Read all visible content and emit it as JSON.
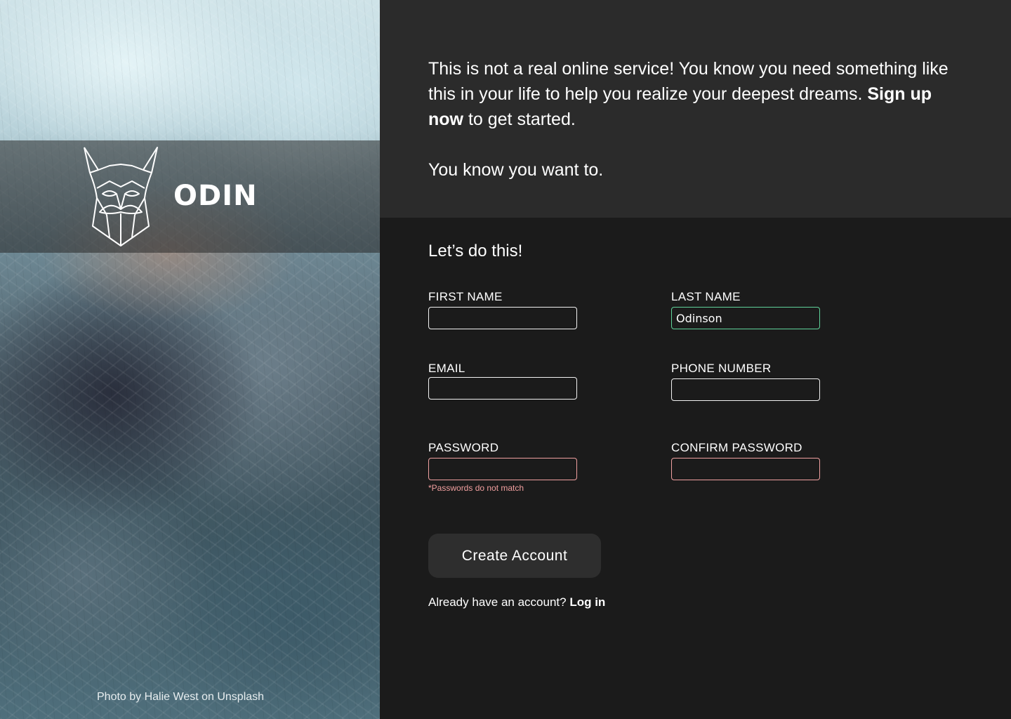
{
  "brand": {
    "name": "ODIN",
    "logo_icon": "viking-head-icon",
    "photo_credit": "Photo by Halie West on Unsplash"
  },
  "intro": {
    "line1": "This is not a real online service! You know you need something like this in your life to help you realize your deepest dreams.",
    "cta_bold": "Sign up now",
    "cta_rest": " to get started.",
    "line2": "You know you want to."
  },
  "form": {
    "heading": "Let’s do this!",
    "fields": {
      "first_name": {
        "label": "FIRST NAME",
        "value": ""
      },
      "last_name": {
        "label": "LAST NAME",
        "value": "Odinson",
        "state": "valid"
      },
      "email": {
        "label": "EMAIL",
        "value": ""
      },
      "phone": {
        "label": "PHONE NUMBER",
        "value": ""
      },
      "password": {
        "label": "PASSWORD",
        "value": "",
        "state": "invalid"
      },
      "confirm_password": {
        "label": "CONFIRM PASSWORD",
        "value": "",
        "state": "invalid"
      }
    },
    "error": "*Passwords do not match",
    "submit_label": "Create Account",
    "login_prompt": "Already have an account? ",
    "login_link": "Log in"
  },
  "colors": {
    "intro_bg": "#2b2b2b",
    "form_bg": "#1b1b1b",
    "valid_border": "#5fd39a",
    "invalid_border": "#f0a0a0",
    "button_bg": "#2e2e2e"
  }
}
